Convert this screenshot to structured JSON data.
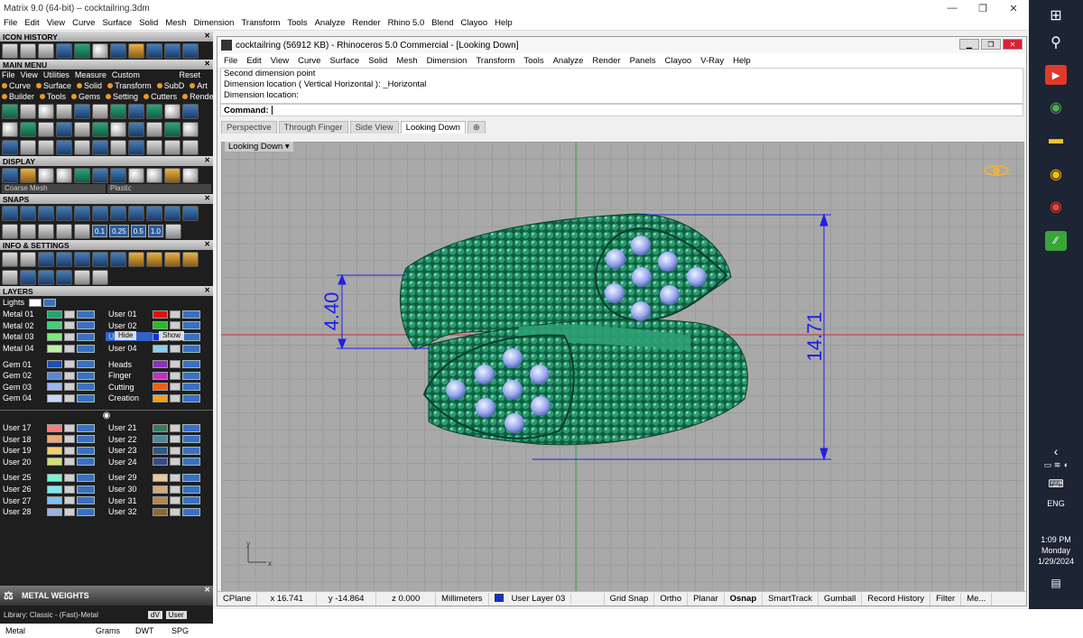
{
  "app": {
    "title": "Matrix 9.0 (64-bit) – cocktailring.3dm",
    "win_min": "—",
    "win_max": "❐",
    "win_close": "✕"
  },
  "menu": [
    "File",
    "Edit",
    "View",
    "Curve",
    "Surface",
    "Solid",
    "Mesh",
    "Dimension",
    "Transform",
    "Tools",
    "Analyze",
    "Render",
    "Rhino 5.0",
    "Blend",
    "Clayoo",
    "Help"
  ],
  "left": {
    "icon_history": "ICON HISTORY",
    "main_menu": "MAIN MENU",
    "main_menu_row": [
      "File",
      "View",
      "Utilities",
      "Measure",
      "Custom"
    ],
    "reset": "Reset",
    "cat_row1": [
      "Curve",
      "Surface",
      "Solid",
      "Transform",
      "SubD",
      "Art"
    ],
    "cat_row2": [
      "Builder",
      "Tools",
      "Gems",
      "Setting",
      "Cutters",
      "Render"
    ],
    "display": "DISPLAY",
    "display_mesh": "Coarse Mesh",
    "display_mat": "Plastic",
    "snaps": "SNAPS",
    "snap_values": [
      "0.1",
      "0.25",
      "0.5",
      "1.0"
    ],
    "info": "INFO & SETTINGS",
    "layers": "LAYERS",
    "lights": "Lights",
    "hide": "Hide",
    "show": "Show",
    "layer_groups": [
      [
        {
          "a": "Metal 01",
          "ac": "#1ea870",
          "b": "User 01",
          "bc": "#e01010"
        },
        {
          "a": "Metal 02",
          "ac": "#3fd07a",
          "b": "User 02",
          "bc": "#20c020"
        },
        {
          "a": "Metal 03",
          "ac": "#7ee87a",
          "b": "User 03",
          "bc": "#1030e0",
          "bsel": true
        },
        {
          "a": "Metal 04",
          "ac": "#bdf0a8",
          "b": "User 04",
          "bc": "#8ad0e8"
        }
      ],
      [
        {
          "a": "Gem 01",
          "ac": "#1f4fb0",
          "b": "Heads",
          "bc": "#9030c0"
        },
        {
          "a": "Gem 02",
          "ac": "#5a86d8",
          "b": "Finger",
          "bc": "#c030c0"
        },
        {
          "a": "Gem 03",
          "ac": "#9ab8f0",
          "b": "Cutting",
          "bc": "#f06010"
        },
        {
          "a": "Gem 04",
          "ac": "#c8d8f8",
          "b": "Creation",
          "bc": "#f0a020"
        }
      ],
      [
        {
          "a": "User 17",
          "ac": "#f08080",
          "b": "User 21",
          "bc": "#3a7a5a"
        },
        {
          "a": "User 18",
          "ac": "#f0a870",
          "b": "User 22",
          "bc": "#4a8a9a"
        },
        {
          "a": "User 19",
          "ac": "#f0d070",
          "b": "User 23",
          "bc": "#2a5a8a"
        },
        {
          "a": "User 20",
          "ac": "#d0e070",
          "b": "User 24",
          "bc": "#3a4a8a"
        }
      ],
      [
        {
          "a": "User 25",
          "ac": "#80f0d0",
          "b": "User 29",
          "bc": "#e8c8a0"
        },
        {
          "a": "User 26",
          "ac": "#80e8f0",
          "b": "User 30",
          "bc": "#d0a880"
        },
        {
          "a": "User 27",
          "ac": "#80c0f0",
          "b": "User 31",
          "bc": "#b08850"
        },
        {
          "a": "User 28",
          "ac": "#a0b0e0",
          "b": "User 32",
          "bc": "#8a6a30"
        }
      ]
    ],
    "metal_weights": "METAL WEIGHTS",
    "library": "Library: Classic - (Fast)-Metal",
    "mw_btn1": "dV",
    "mw_btn2": "User",
    "cols": [
      "Metal",
      "Grams",
      "DWT",
      "SPG"
    ]
  },
  "rhino": {
    "title": "cocktailring (56912 KB) - Rhinoceros 5.0 Commercial - [Looking Down]",
    "menu": [
      "File",
      "Edit",
      "View",
      "Curve",
      "Surface",
      "Solid",
      "Mesh",
      "Dimension",
      "Transform",
      "Tools",
      "Analyze",
      "Render",
      "Panels",
      "Clayoo",
      "V-Ray",
      "Help"
    ],
    "history": [
      "Second dimension point",
      "Dimension location ( Vertical  Horizontal ): _Horizontal",
      "Dimension location:"
    ],
    "command_label": "Command:",
    "tabs": [
      "Perspective",
      "Through Finger",
      "Side View",
      "Looking Down"
    ],
    "tab_add": "⊕",
    "viewport_label": "Looking Down",
    "dim_left": "4.40",
    "dim_right": "14.71",
    "axis_y": "y",
    "axis_x": "x"
  },
  "status": {
    "cplane": "CPlane",
    "x": "x 16.741",
    "y": "y -14.864",
    "z": "z 0.000",
    "units": "Millimeters",
    "layer": "User Layer 03",
    "layer_color": "#1030e0",
    "toggles": [
      "Grid Snap",
      "Ortho",
      "Planar",
      "Osnap",
      "SmartTrack",
      "Gumball",
      "Record History",
      "Filter",
      "Me..."
    ]
  },
  "taskbar": {
    "time": "1:09 PM",
    "day": "Monday",
    "date": "1/29/2024",
    "lang": "ENG"
  }
}
